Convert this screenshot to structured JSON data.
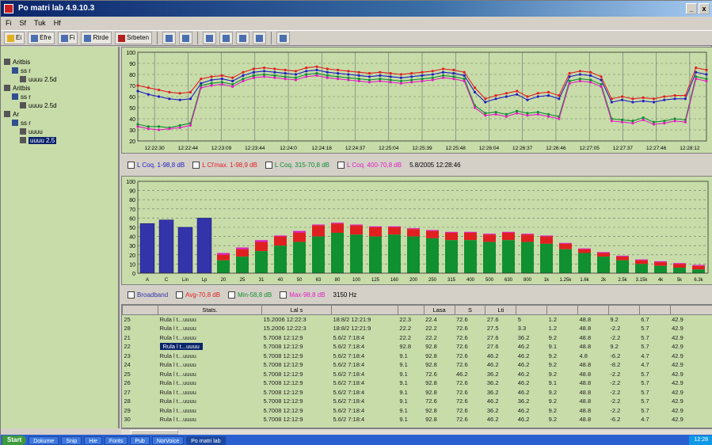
{
  "window": {
    "title": "Po matri lab 4.9.10.3",
    "controls": [
      "_",
      "x"
    ]
  },
  "menu": {
    "items": [
      "Fi",
      "Sf",
      "Tuk",
      "Hf"
    ]
  },
  "toolbar": {
    "items": [
      "Ei",
      "Efre",
      "Fi",
      "Rtrde",
      "Srbeten"
    ]
  },
  "tree": {
    "nodes": [
      {
        "label": "Aritbis",
        "depth": 0,
        "icon": "folder-icon",
        "selected": false
      },
      {
        "label": "ss r",
        "depth": 1,
        "icon": "computer-icon",
        "selected": false
      },
      {
        "label": "uuuu 2.5d",
        "depth": 2,
        "icon": "file-icon",
        "selected": false
      },
      {
        "label": "Aritbis",
        "depth": 0,
        "icon": "folder-icon",
        "selected": false
      },
      {
        "label": "ss r",
        "depth": 1,
        "icon": "computer-icon",
        "selected": false
      },
      {
        "label": "uuuu 2.5d",
        "depth": 2,
        "icon": "file-icon",
        "selected": false
      },
      {
        "label": "Ar",
        "depth": 0,
        "icon": "folder-icon",
        "selected": false
      },
      {
        "label": "ss r",
        "depth": 1,
        "icon": "computer-icon",
        "selected": false
      },
      {
        "label": "uuuu",
        "depth": 2,
        "icon": "file-icon",
        "selected": false
      },
      {
        "label": "uuuu 2.5",
        "depth": 2,
        "icon": "file-icon",
        "selected": true
      }
    ]
  },
  "legend_top": {
    "items": [
      {
        "label": "L Coq. 1-98,8 dB",
        "color": "#2020c0"
      },
      {
        "label": "L Cl'max. 1-98,9 dB",
        "color": "#e02020"
      },
      {
        "label": "L Coq. 315-70,8 dB",
        "color": "#109030"
      },
      {
        "label": "L Coq. 400-70,8 dB",
        "color": "#e020c0"
      }
    ],
    "timestamp": "5.8/2005 12:28:46"
  },
  "legend_bottom": {
    "items": [
      {
        "label": "Broadband",
        "color": "#3333aa"
      },
      {
        "label": "Avg-70,8 dB",
        "color": "#e02020"
      },
      {
        "label": "Min-58,8 dB",
        "color": "#109030"
      },
      {
        "label": "Max-98,8 dB",
        "color": "#e020c0"
      }
    ],
    "extra": "3150 Hz"
  },
  "table": {
    "headers": [
      "",
      "Stats.",
      "Lal s",
      "",
      "",
      "Lasa",
      "S",
      "Lti",
      "",
      "",
      "",
      "",
      "",
      ""
    ],
    "rows": [
      [
        "25",
        "Rula l t...uuuu",
        "15.2006 12:22:3",
        "18:8/2 12:21:9",
        "22.3",
        "22.4",
        "72.6",
        "27.6",
        "5",
        "1.2",
        "48.8",
        "9.2",
        "6.7",
        "42.9"
      ],
      [
        "28",
        "Rula l t...uuuu",
        "15.2006 12:22:3",
        "18:8/2 12:21:9",
        "22.2",
        "22.2",
        "72.6",
        "27.5",
        "3.3",
        "1.2",
        "48.8",
        "-2.2",
        "5.7",
        "42.9"
      ],
      [
        "21",
        "Rula l t...uuuu",
        "5.7008 12:12:9",
        "5.6/2 7:18:4",
        "22.2",
        "22.2",
        "72.6",
        "27.6",
        "36.2",
        "9.2",
        "48.8",
        "-2.2",
        "5.7",
        "42.9"
      ],
      [
        "22",
        "Rula l t...uuuu",
        "5.7008 12:12:9",
        "5.6/2 7:18:4",
        "92.8",
        "92.8",
        "72.6",
        "27.6",
        "46.2",
        "9.1",
        "48.8",
        "9.2",
        "5.7",
        "42.9"
      ],
      [
        "23",
        "Rula l t...uuuu",
        "5.7008 12:12:9",
        "5.6/2 7:18:4",
        "9.1",
        "92.8",
        "72.6",
        "46.2",
        "46.2",
        "9.2",
        "4.8",
        "-6.2",
        "4.7",
        "42.9"
      ],
      [
        "24",
        "Rula l t...uuuu",
        "5.7008 12:12:9",
        "5.6/2 7:18:4",
        "9.1",
        "92.8",
        "72.6",
        "46.2",
        "46.2",
        "9.2",
        "48.8",
        "-8.2",
        "4.7",
        "42.9"
      ],
      [
        "25",
        "Rula l t...uuuu",
        "5.7008 12:12:9",
        "5.6/2 7:18:4",
        "9.1",
        "72.6",
        "46.2",
        "36.2",
        "46.2",
        "9.2",
        "48.8",
        "-2.2",
        "5.7",
        "42.9"
      ],
      [
        "26",
        "Rula l t...uuuu",
        "5.7008 12:12:9",
        "5.6/2 7:18:4",
        "9.1",
        "92.8",
        "72.6",
        "36.2",
        "46.2",
        "9.1",
        "48.8",
        "-2.2",
        "5.7",
        "42.9"
      ],
      [
        "27",
        "Rula l t...uuuu",
        "5.7008 12:12:9",
        "5.6/2 7:18:4",
        "9.1",
        "92.8",
        "72.6",
        "36.2",
        "46.2",
        "9.2",
        "48.8",
        "-2.2",
        "5.7",
        "42.9"
      ],
      [
        "28",
        "Rula l t...uuuu",
        "5.7008 12:12:9",
        "5.6/2 7:18:4",
        "9.1",
        "72.6",
        "72.6",
        "46.2",
        "36.2",
        "9.2",
        "48.8",
        "-2.2",
        "5.7",
        "42.9"
      ],
      [
        "29",
        "Rula l t...uuuu",
        "5.7008 12:12:9",
        "5.6/2 7:18:4",
        "9.1",
        "92.8",
        "72.6",
        "36.2",
        "46.2",
        "9.2",
        "48.8",
        "-2.2",
        "5.7",
        "42.9"
      ],
      [
        "30",
        "Rula l t...uuuu",
        "5.7008 12:12:9",
        "5.6/2 7:18:4",
        "9.1",
        "92.8",
        "72.6",
        "46.2",
        "46.2",
        "9.2",
        "48.8",
        "-6.2",
        "4.7",
        "42.9"
      ]
    ],
    "selected_row": 3
  },
  "taskbar": {
    "start": "Start",
    "tasks": [
      "Dokume",
      "Snip",
      "Hie",
      "Fonts",
      "Pub",
      "NorVoice",
      "Po matri lab"
    ],
    "active_task": "Po matri lab",
    "clock": "12:28"
  },
  "chart_data": [
    {
      "type": "line",
      "ylim": [
        20,
        100
      ],
      "yticks": [
        20,
        30,
        40,
        50,
        60,
        70,
        80,
        90,
        100
      ],
      "xticklabels": [
        "12:22:30",
        "12:22:44",
        "12:23:09",
        "12:23:44",
        "12:24:0",
        "12:24:18",
        "12:24:37",
        "12:25:04",
        "12:25:39",
        "12:25:48",
        "12:26:04",
        "12:26:37",
        "12:26:46",
        "12:27:05",
        "12:27:37",
        "12:27:46",
        "12:28:12"
      ],
      "series": [
        {
          "name": "L Coq. 1-98,8 dB",
          "color": "#2020c0",
          "values": [
            65,
            62,
            60,
            58,
            57,
            58,
            72,
            75,
            76,
            74,
            79,
            82,
            83,
            82,
            81,
            80,
            83,
            84,
            82,
            81,
            80,
            79,
            78,
            79,
            78,
            77,
            78,
            79,
            80,
            82,
            81,
            79,
            64,
            55,
            58,
            60,
            62,
            57,
            60,
            61,
            58,
            78,
            80,
            79,
            75,
            55,
            57,
            55,
            56,
            55,
            57,
            58,
            58,
            82,
            80
          ]
        },
        {
          "name": "L Cl'max. 1-98,9 dB",
          "color": "#e02020",
          "values": [
            70,
            68,
            66,
            64,
            63,
            64,
            76,
            78,
            79,
            77,
            82,
            85,
            86,
            85,
            84,
            83,
            86,
            87,
            85,
            84,
            83,
            82,
            81,
            82,
            81,
            80,
            81,
            82,
            83,
            85,
            84,
            82,
            68,
            58,
            61,
            63,
            65,
            60,
            63,
            64,
            61,
            81,
            83,
            82,
            78,
            58,
            60,
            58,
            59,
            58,
            60,
            61,
            61,
            86,
            84
          ]
        },
        {
          "name": "L Coq. 315-70,8 dB",
          "color": "#109030",
          "values": [
            35,
            33,
            33,
            32,
            34,
            36,
            70,
            72,
            73,
            71,
            76,
            79,
            80,
            79,
            78,
            77,
            80,
            81,
            79,
            78,
            77,
            76,
            75,
            76,
            75,
            74,
            75,
            76,
            77,
            79,
            78,
            76,
            52,
            45,
            46,
            44,
            47,
            45,
            46,
            44,
            42,
            74,
            76,
            75,
            71,
            40,
            39,
            38,
            41,
            37,
            38,
            40,
            39,
            78,
            76
          ]
        },
        {
          "name": "L Coq. 400-70,8 dB",
          "color": "#e020c0",
          "values": [
            33,
            31,
            30,
            31,
            32,
            34,
            68,
            70,
            71,
            69,
            74,
            77,
            78,
            77,
            76,
            75,
            78,
            79,
            77,
            76,
            75,
            74,
            73,
            74,
            73,
            72,
            73,
            74,
            75,
            77,
            76,
            74,
            50,
            43,
            44,
            42,
            45,
            43,
            44,
            42,
            40,
            72,
            74,
            73,
            69,
            38,
            37,
            36,
            39,
            35,
            36,
            38,
            37,
            76,
            74
          ]
        }
      ]
    },
    {
      "type": "bar",
      "ylim": [
        0,
        100
      ],
      "yticks": [
        0,
        10,
        20,
        30,
        40,
        50,
        60,
        70,
        80,
        90,
        100
      ],
      "categories": [
        "A",
        "C",
        "Lin",
        "Lp",
        "20",
        "25",
        "31",
        "40",
        "50",
        "63",
        "80",
        "100",
        "125",
        "160",
        "200",
        "250",
        "315",
        "400",
        "500",
        "630",
        "800",
        "1k",
        "1.25k",
        "1.6k",
        "2k",
        "2.5k",
        "3.15k",
        "4k",
        "5k",
        "6.3k"
      ],
      "broadband": [
        54,
        58,
        50,
        60
      ],
      "series": [
        {
          "name": "Min",
          "color": "#109030",
          "values": [
            6,
            4,
            8,
            10,
            14,
            18,
            24,
            30,
            34,
            40,
            44,
            42,
            40,
            42,
            40,
            38,
            36,
            36,
            34,
            36,
            34,
            32,
            26,
            22,
            18,
            14,
            10,
            8,
            6,
            4
          ]
        },
        {
          "name": "Avg",
          "color": "#e02020",
          "values": [
            22,
            10,
            16,
            16,
            20,
            26,
            34,
            40,
            44,
            52,
            54,
            52,
            50,
            50,
            48,
            46,
            44,
            44,
            42,
            44,
            42,
            40,
            32,
            26,
            22,
            18,
            14,
            12,
            10,
            8
          ]
        },
        {
          "name": "Max",
          "color": "#e020c0",
          "values": [
            24,
            11,
            17,
            17,
            22,
            28,
            36,
            41,
            46,
            53,
            55,
            53,
            51,
            51,
            49,
            47,
            45,
            45,
            43,
            45,
            43,
            41,
            33,
            27,
            23,
            19,
            15,
            13,
            11,
            9
          ]
        }
      ]
    }
  ]
}
